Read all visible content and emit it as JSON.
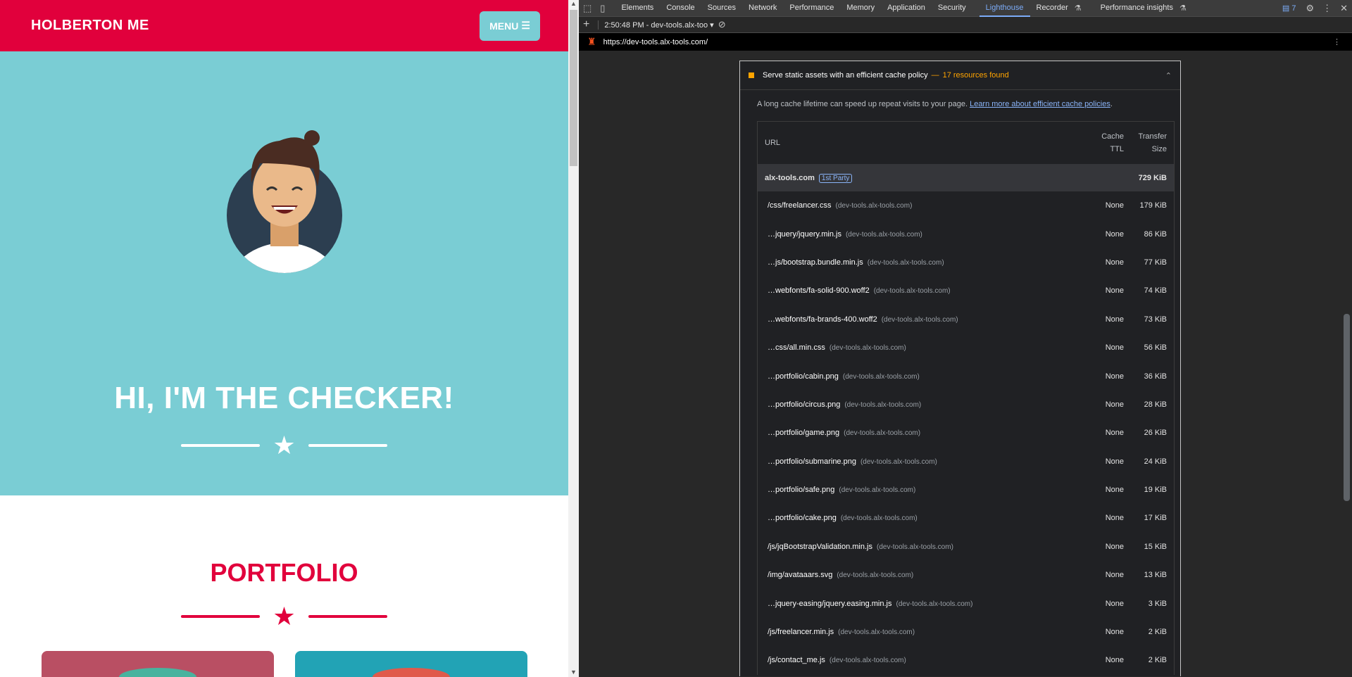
{
  "site": {
    "brand": "HOLBERTON ME",
    "menu_label": "MENU",
    "hero_title": "HI, I'M THE CHECKER!",
    "portfolio_title": "PORTFOLIO",
    "colors": {
      "primary": "#e1003c",
      "hero": "#7acdd4",
      "card1": "#b94f63",
      "card2": "#22a3b5"
    }
  },
  "devtools": {
    "tabs": [
      "Elements",
      "Console",
      "Sources",
      "Network",
      "Performance",
      "Memory",
      "Application",
      "Security",
      "Lighthouse",
      "Recorder",
      "Performance insights"
    ],
    "active_tab": "Lighthouse",
    "issues_count": "7",
    "report_selector": "2:50:48 PM - dev-tools.alx-too",
    "url": "https://dev-tools.alx-tools.com/",
    "audit": {
      "title": "Serve static assets with an efficient cache policy",
      "sep": "—",
      "summary": "17 resources found",
      "description": "A long cache lifetime can speed up repeat visits to your page.",
      "link": "Learn more about efficient cache policies",
      "period": ".",
      "headers": {
        "url": "URL",
        "ttl_1": "Cache",
        "ttl_2": "TTL",
        "size_1": "Transfer",
        "size_2": "Size"
      },
      "group": {
        "name": "alx-tools.com",
        "badge": "1st Party",
        "size": "729 KiB"
      },
      "rows": [
        {
          "url": "/css/freelancer.css",
          "host": "(dev-tools.alx-tools.com)",
          "ttl": "None",
          "size": "179 KiB"
        },
        {
          "url": "…jquery/jquery.min.js",
          "host": "(dev-tools.alx-tools.com)",
          "ttl": "None",
          "size": "86 KiB"
        },
        {
          "url": "…js/bootstrap.bundle.min.js",
          "host": "(dev-tools.alx-tools.com)",
          "ttl": "None",
          "size": "77 KiB"
        },
        {
          "url": "…webfonts/fa-solid-900.woff2",
          "host": "(dev-tools.alx-tools.com)",
          "ttl": "None",
          "size": "74 KiB"
        },
        {
          "url": "…webfonts/fa-brands-400.woff2",
          "host": "(dev-tools.alx-tools.com)",
          "ttl": "None",
          "size": "73 KiB"
        },
        {
          "url": "…css/all.min.css",
          "host": "(dev-tools.alx-tools.com)",
          "ttl": "None",
          "size": "56 KiB"
        },
        {
          "url": "…portfolio/cabin.png",
          "host": "(dev-tools.alx-tools.com)",
          "ttl": "None",
          "size": "36 KiB"
        },
        {
          "url": "…portfolio/circus.png",
          "host": "(dev-tools.alx-tools.com)",
          "ttl": "None",
          "size": "28 KiB"
        },
        {
          "url": "…portfolio/game.png",
          "host": "(dev-tools.alx-tools.com)",
          "ttl": "None",
          "size": "26 KiB"
        },
        {
          "url": "…portfolio/submarine.png",
          "host": "(dev-tools.alx-tools.com)",
          "ttl": "None",
          "size": "24 KiB"
        },
        {
          "url": "…portfolio/safe.png",
          "host": "(dev-tools.alx-tools.com)",
          "ttl": "None",
          "size": "19 KiB"
        },
        {
          "url": "…portfolio/cake.png",
          "host": "(dev-tools.alx-tools.com)",
          "ttl": "None",
          "size": "17 KiB"
        },
        {
          "url": "/js/jqBootstrapValidation.min.js",
          "host": "(dev-tools.alx-tools.com)",
          "ttl": "None",
          "size": "15 KiB"
        },
        {
          "url": "/img/avataaars.svg",
          "host": "(dev-tools.alx-tools.com)",
          "ttl": "None",
          "size": "13 KiB"
        },
        {
          "url": "…jquery-easing/jquery.easing.min.js",
          "host": "(dev-tools.alx-tools.com)",
          "ttl": "None",
          "size": "3 KiB"
        },
        {
          "url": "/js/freelancer.min.js",
          "host": "(dev-tools.alx-tools.com)",
          "ttl": "None",
          "size": "2 KiB"
        },
        {
          "url": "/js/contact_me.js",
          "host": "(dev-tools.alx-tools.com)",
          "ttl": "None",
          "size": "2 KiB"
        }
      ]
    }
  }
}
